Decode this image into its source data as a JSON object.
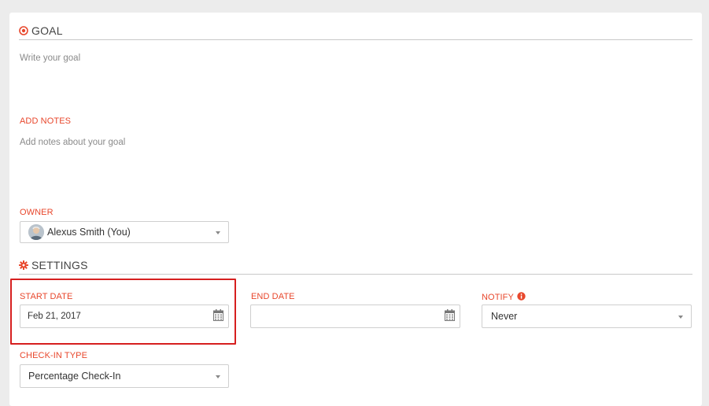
{
  "goal": {
    "title": "GOAL",
    "placeholder": "Write your goal"
  },
  "notes": {
    "label": "ADD NOTES",
    "placeholder": "Add notes about your goal"
  },
  "owner": {
    "label": "OWNER",
    "value": "Alexus Smith (You)"
  },
  "settings": {
    "title": "SETTINGS",
    "start_date": {
      "label": "START DATE",
      "value": "Feb 21, 2017"
    },
    "end_date": {
      "label": "END DATE",
      "value": ""
    },
    "notify": {
      "label": "NOTIFY",
      "value": "Never"
    },
    "checkin_type": {
      "label": "CHECK-IN TYPE",
      "value": "Percentage Check-In"
    }
  },
  "colors": {
    "accent": "#e8472c",
    "highlight_border": "#d61f1f"
  },
  "icons": {
    "goal": "target-icon",
    "settings": "gear-icon",
    "calendar": "calendar-icon",
    "info": "info-icon",
    "dropdown": "caret-down-icon"
  }
}
